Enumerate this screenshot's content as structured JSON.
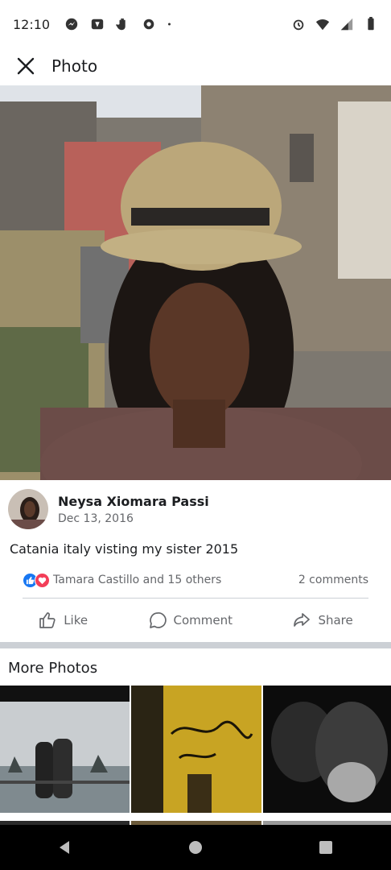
{
  "status_bar": {
    "time": "12:10",
    "left_icons": [
      "messenger-icon",
      "app-icon",
      "hand-icon",
      "shield-icon",
      "dot-icon"
    ],
    "right_icons": [
      "alarm-icon",
      "wifi-icon",
      "signal-icon",
      "battery-icon"
    ]
  },
  "header": {
    "title": "Photo",
    "close_icon": "close-icon"
  },
  "post": {
    "author_name": "Neysa Xiomara Passi",
    "date": "Dec 13, 2016",
    "caption": "Catania italy visting my sister 2015",
    "reactions_text": "Tamara Castillo and 15 others",
    "comments_text": "2 comments"
  },
  "actions": {
    "like": "Like",
    "comment": "Comment",
    "share": "Share"
  },
  "more_photos": {
    "title": "More Photos"
  },
  "colors": {
    "like_blue": "#1877f2",
    "love_red": "#f33e58",
    "separator": "#ccd0d5",
    "secondary_text": "#65676b"
  }
}
